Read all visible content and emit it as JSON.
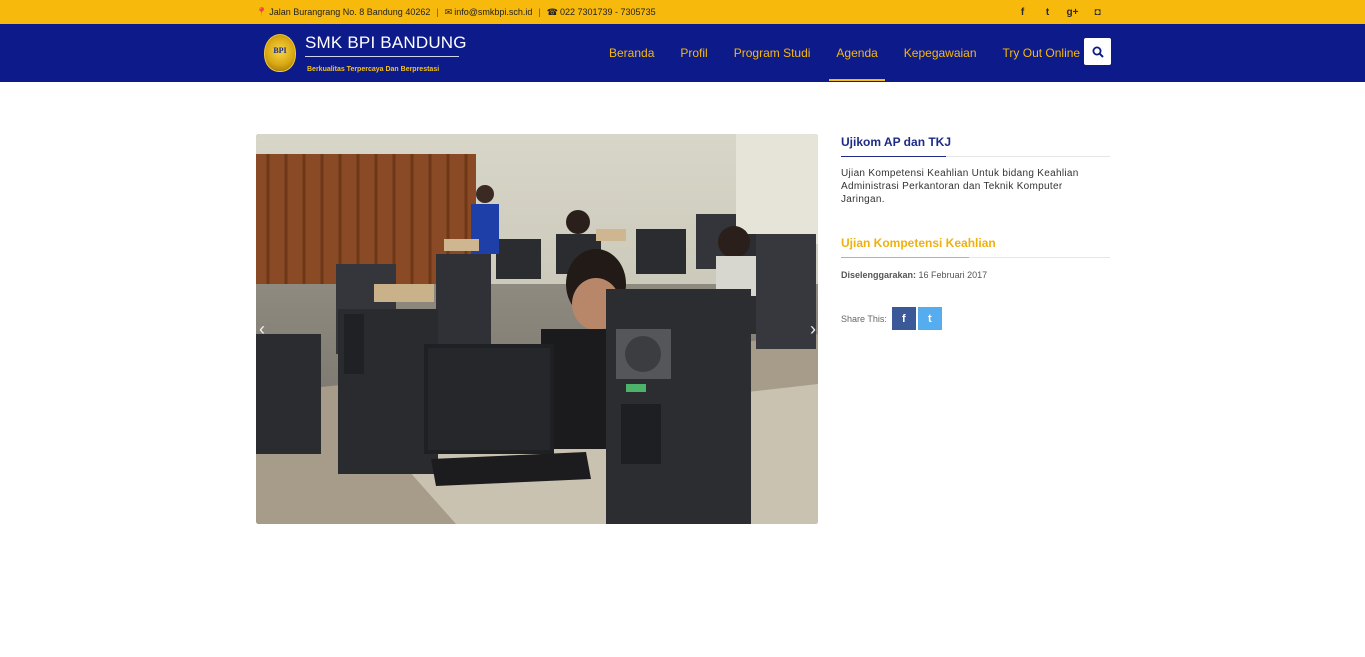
{
  "topbar": {
    "address": "Jalan Burangrang No. 8 Bandung 40262",
    "email": "info@smkbpi.sch.id",
    "phone": "022 7301739 - 7305735",
    "social": [
      {
        "icon": "facebook-icon",
        "glyph": "f"
      },
      {
        "icon": "twitter-icon",
        "glyph": "t"
      },
      {
        "icon": "google-plus-icon",
        "glyph": "g+"
      },
      {
        "icon": "instagram-icon",
        "glyph": "◘"
      }
    ]
  },
  "brand": {
    "emblem_text": "BPI",
    "name": "SMK BPI BANDUNG",
    "tagline": "Berkualitas Terpercaya Dan Berprestasi"
  },
  "nav": {
    "items": [
      "Beranda",
      "Profil",
      "Program Studi",
      "Agenda",
      "Kepegawaian",
      "Try Out Online"
    ],
    "active": "Agenda",
    "search_icon": "search-icon"
  },
  "slider": {
    "prev": "‹",
    "next": "›",
    "image_alt": "Siswa mengikuti ujian di laboratorium komputer"
  },
  "article": {
    "title": "Ujikom AP dan TKJ",
    "description": "Ujian Kompetensi Keahlian Untuk bidang Keahlian Administrasi Perkantoran dan Teknik Komputer Jaringan.",
    "subtitle": "Ujian Kompetensi Keahlian",
    "meta_label": "Diselenggarakan:",
    "meta_value": "16 Februari 2017",
    "share_label": "Share This:",
    "share_facebook": "f",
    "share_twitter": "t"
  },
  "colors": {
    "topbar": "#f7b90c",
    "navbar": "#0d1a8a",
    "accent_blue": "#1e2a86",
    "accent_yellow": "#f0b10e",
    "facebook": "#3b5998",
    "twitter": "#55acee"
  }
}
